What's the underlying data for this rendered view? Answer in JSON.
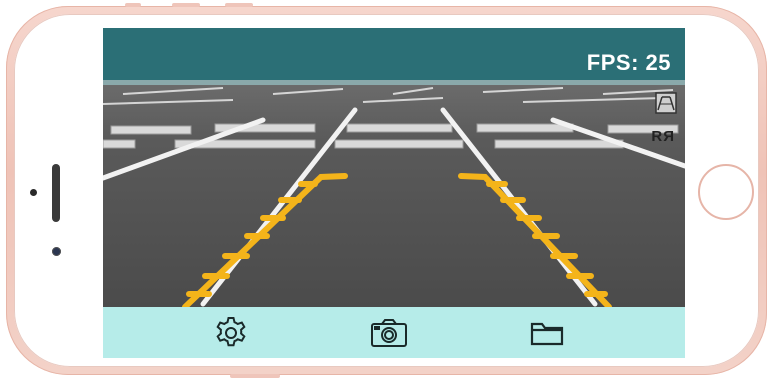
{
  "status": {
    "fps_text": "FPS: 25"
  },
  "camera": {
    "overlay_icon": "guideline-overlay-icon",
    "mirror_icon": "mirror-icon",
    "mirror_text": "RЯ"
  },
  "toolbar": {
    "settings_icon": "gear-icon",
    "capture_icon": "camera-icon",
    "gallery_icon": "folder-icon"
  },
  "colors": {
    "header": "#2b6f76",
    "toolbar": "#b6ece9",
    "guideline": "#f4b41a",
    "phone_body": "#f0c6ba"
  }
}
